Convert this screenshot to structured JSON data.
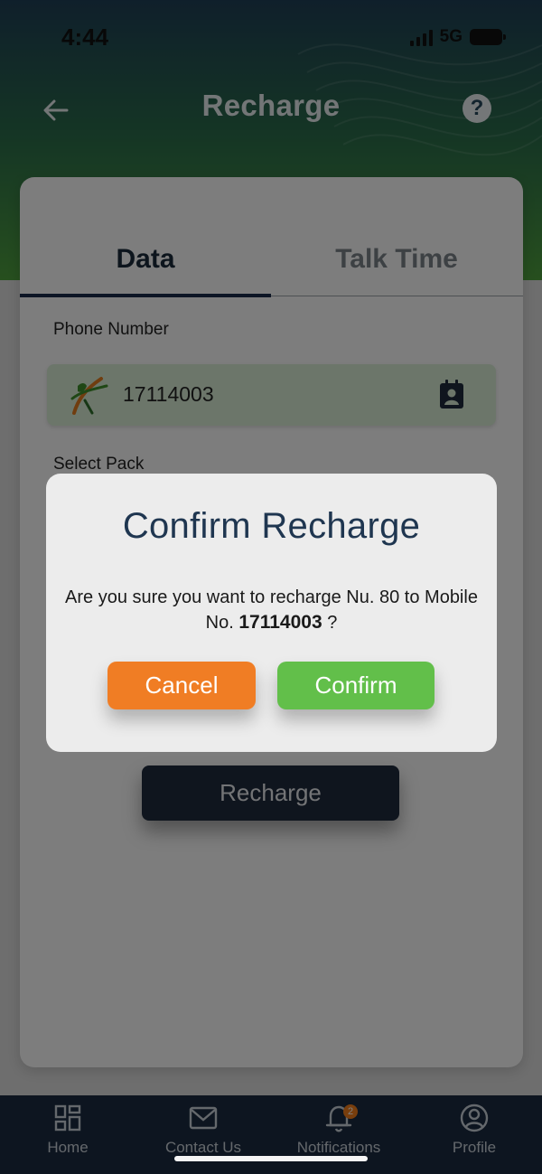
{
  "status_bar": {
    "time": "4:44",
    "network": "5G"
  },
  "header": {
    "title": "Recharge",
    "help_glyph": "?"
  },
  "tabs": [
    {
      "label": "Data",
      "active": true
    },
    {
      "label": "Talk Time",
      "active": false
    }
  ],
  "form": {
    "phone_label": "Phone Number",
    "phone_value": "17114003",
    "select_pack_label": "Select Pack",
    "recharge_button": "Recharge"
  },
  "dialog": {
    "title": "Confirm Recharge",
    "message_prefix": "Are you sure you want to recharge Nu. 80 to Mobile No.",
    "mobile_number": "17114003",
    "message_suffix": "?",
    "cancel_label": "Cancel",
    "confirm_label": "Confirm"
  },
  "bottom_nav": [
    {
      "label": "Home",
      "icon": "grid-icon"
    },
    {
      "label": "Contact Us",
      "icon": "mail-icon"
    },
    {
      "label": "Notifications",
      "icon": "bell-icon",
      "badge": "2"
    },
    {
      "label": "Profile",
      "icon": "user-circle-icon"
    }
  ],
  "colors": {
    "primary_dark": "#1f2a3c",
    "brand_green": "#62bf4a",
    "accent_orange": "#f07d24",
    "title_blue": "#1f3650"
  }
}
